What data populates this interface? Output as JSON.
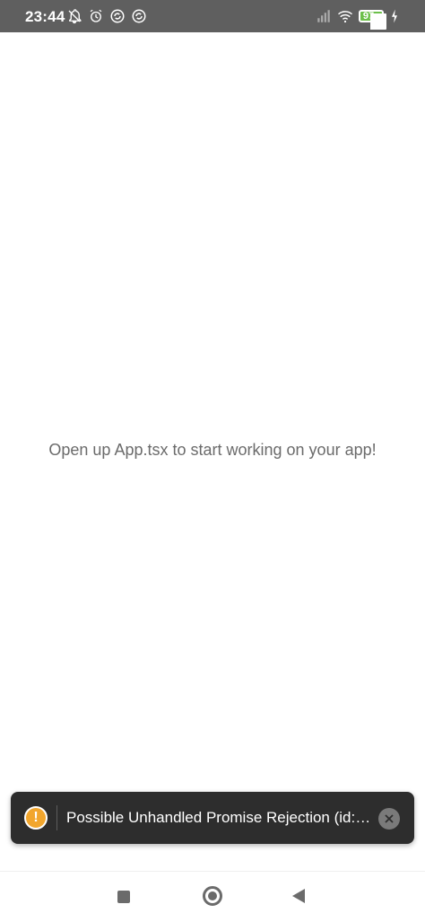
{
  "status_bar": {
    "time": "23:44",
    "battery_level": "97",
    "left_icons": [
      "muted-bell-icon",
      "alarm-icon",
      "sync-icon",
      "sync-icon"
    ],
    "right_icons": [
      "signal-icon",
      "wifi-icon",
      "battery-icon",
      "charging-icon"
    ],
    "background_color": "#5f5f5f"
  },
  "main": {
    "message": "Open up App.tsx to start working on your app!"
  },
  "toast": {
    "icon": "warning-icon",
    "text": "Possible Unhandled Promise Rejection (id: ...",
    "close_icon": "close-icon",
    "icon_color": "#f2a62d"
  },
  "nav_bar": {
    "recents_icon": "square-icon",
    "home_icon": "home-icon",
    "back_icon": "back-icon"
  }
}
